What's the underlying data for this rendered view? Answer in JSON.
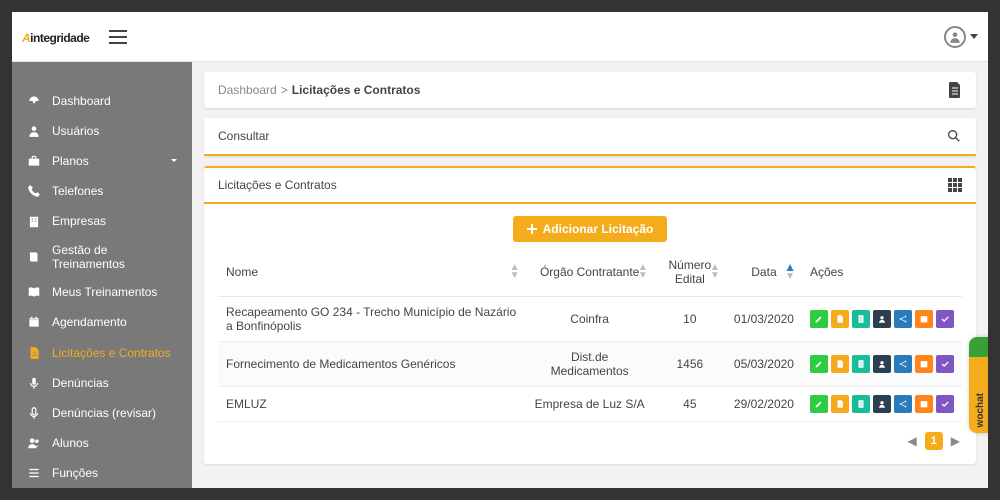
{
  "logo": {
    "accent": "A",
    "rest": "integridade"
  },
  "breadcrumb": {
    "root": "Dashboard",
    "sep": ">",
    "current": "Licitações e Contratos"
  },
  "consultar": {
    "label": "Consultar"
  },
  "lista": {
    "title": "Licitações e Contratos",
    "add_label": "Adicionar Licitação",
    "columns": {
      "nome": "Nome",
      "orgao": "Órgão Contratante",
      "numero": "Número Edital",
      "data": "Data",
      "acoes": "Ações"
    },
    "rows": [
      {
        "nome": "Recapeamento GO 234 - Trecho Município de Nazário a Bonfinópolis",
        "orgao": "Coinfra",
        "numero": "10",
        "data": "01/03/2020"
      },
      {
        "nome": "Fornecimento de Medicamentos Genéricos",
        "orgao": "Dist.de Medicamentos",
        "numero": "1456",
        "data": "05/03/2020"
      },
      {
        "nome": "EMLUZ",
        "orgao": "Empresa de Luz S/A",
        "numero": "45",
        "data": "29/02/2020"
      }
    ],
    "action_icons": [
      "edit",
      "doc",
      "form",
      "member",
      "share",
      "calendar",
      "check"
    ],
    "action_colors": [
      "c-green",
      "c-amber",
      "c-teal",
      "c-navy",
      "c-blue",
      "c-orange",
      "c-purple"
    ]
  },
  "pager": {
    "current": "1"
  },
  "sidebar": {
    "items": [
      {
        "key": "dashboard",
        "label": "Dashboard",
        "icon": "gauge"
      },
      {
        "key": "usuarios",
        "label": "Usuários",
        "icon": "user"
      },
      {
        "key": "planos",
        "label": "Planos",
        "icon": "briefcase",
        "has_children": true
      },
      {
        "key": "telefones",
        "label": "Telefones",
        "icon": "phone"
      },
      {
        "key": "empresas",
        "label": "Empresas",
        "icon": "building"
      },
      {
        "key": "gestao-trein",
        "label": "Gestão de Treinamentos",
        "icon": "book"
      },
      {
        "key": "meus-trein",
        "label": "Meus Treinamentos",
        "icon": "book-open"
      },
      {
        "key": "agendamento",
        "label": "Agendamento",
        "icon": "calendar"
      },
      {
        "key": "licitacoes",
        "label": "Licitações e Contratos",
        "icon": "file",
        "active": true
      },
      {
        "key": "denuncias",
        "label": "Denúncias",
        "icon": "mic"
      },
      {
        "key": "denuncias-rev",
        "label": "Denúncias (revisar)",
        "icon": "mic-outline"
      },
      {
        "key": "alunos",
        "label": "Alunos",
        "icon": "users"
      },
      {
        "key": "funcoes",
        "label": "Funções",
        "icon": "list"
      }
    ]
  },
  "chat": {
    "label": "wochat"
  }
}
